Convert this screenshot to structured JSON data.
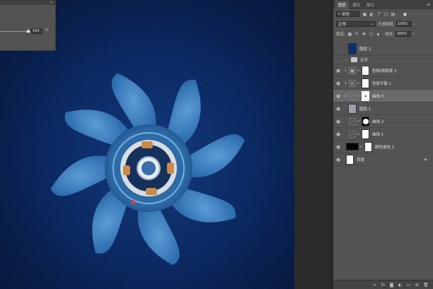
{
  "properties_panel": {
    "value": "100",
    "unit": "%",
    "close_glyph": "«"
  },
  "layers_panel": {
    "tabs": [
      "图层",
      "通道",
      "路径"
    ],
    "filter_kind": "类型",
    "blend_mode": "正常",
    "opacity_label": "不透明度:",
    "opacity_value": "100%",
    "lock_label": "锁定:",
    "fill_label": "填充:",
    "fill_value": "100%",
    "layers": [
      {
        "name": "图层 2"
      },
      {
        "name": "文字"
      },
      {
        "name": "色相/饱和度 1"
      },
      {
        "name": "色彩平衡 1"
      },
      {
        "name": "曲线 3"
      },
      {
        "name": "图层 1"
      },
      {
        "name": "曲线 2"
      },
      {
        "name": "曲线 1"
      },
      {
        "name": "颜色填充 1"
      },
      {
        "name": "背景"
      }
    ],
    "bottom_icons": [
      "link-icon",
      "fx-icon",
      "mask-icon",
      "adjustment-icon",
      "group-icon",
      "new-layer-icon",
      "trash-icon"
    ]
  },
  "colors": {
    "canvas_bg": "#0c2a63",
    "fan_blade": "#3f86c6",
    "panel_bg": "#535353",
    "selected_layer": "#6a6a6a"
  }
}
